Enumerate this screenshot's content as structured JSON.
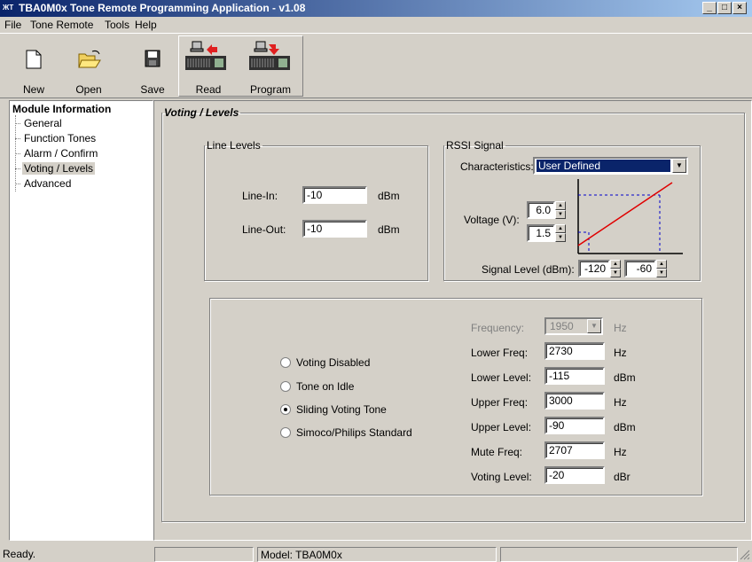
{
  "window": {
    "logo": "ЖТ",
    "title": "TBA0M0x Tone Remote Programming Application - v1.08",
    "btn_min": "_",
    "btn_max": "□",
    "btn_close": "×"
  },
  "menu": {
    "file": "File",
    "tone_remote": "Tone Remote",
    "tools": "Tools",
    "help": "Help"
  },
  "toolbar": {
    "new": "New",
    "open": "Open",
    "save": "Save",
    "read": "Read",
    "program": "Program"
  },
  "tree": {
    "root": "Module Information",
    "items": [
      "General",
      "Function Tones",
      "Alarm / Confirm",
      "Voting / Levels",
      "Advanced"
    ],
    "selected": "Voting / Levels"
  },
  "panel": {
    "title": "Voting / Levels",
    "line_levels": {
      "legend": "Line Levels",
      "line_in_label": "Line-In:",
      "line_in_value": "-10",
      "line_in_unit": "dBm",
      "line_out_label": "Line-Out:",
      "line_out_value": "-10",
      "line_out_unit": "dBm"
    },
    "rssi": {
      "legend": "RSSI Signal",
      "characteristics_label": "Characteristics:",
      "characteristics_value": "User Defined",
      "voltage_label": "Voltage (V):",
      "voltage_high": "6.0",
      "voltage_low": "1.5",
      "signal_label": "Signal Level (dBm):",
      "signal_low": "-120",
      "signal_high": "-60"
    },
    "voting": {
      "options": [
        "Voting Disabled",
        "Tone on Idle",
        "Sliding Voting Tone",
        "Simoco/Philips Standard"
      ],
      "selected_index": 2,
      "frequency_label": "Frequency:",
      "frequency_value": "1950",
      "frequency_unit": "Hz",
      "lower_freq_label": "Lower Freq:",
      "lower_freq_value": "2730",
      "lower_freq_unit": "Hz",
      "lower_level_label": "Lower Level:",
      "lower_level_value": "-115",
      "lower_level_unit": "dBm",
      "upper_freq_label": "Upper Freq:",
      "upper_freq_value": "3000",
      "upper_freq_unit": "Hz",
      "upper_level_label": "Upper Level:",
      "upper_level_value": "-90",
      "upper_level_unit": "dBm",
      "mute_freq_label": "Mute Freq:",
      "mute_freq_value": "2707",
      "mute_freq_unit": "Hz",
      "voting_level_label": "Voting Level:",
      "voting_level_value": "-20",
      "voting_level_unit": "dBr"
    }
  },
  "status": {
    "ready": "Ready.",
    "model": "Model: TBA0M0x"
  }
}
